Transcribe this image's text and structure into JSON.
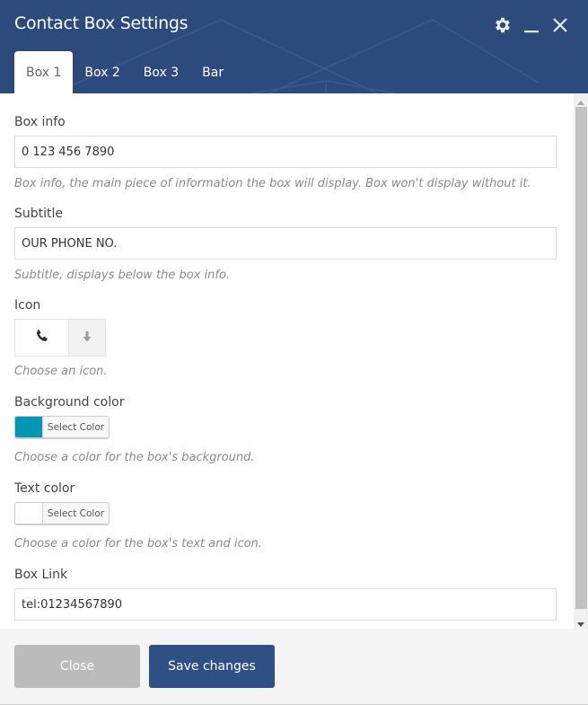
{
  "header": {
    "title": "Contact Box Settings",
    "actions": [
      {
        "icon": "gear-icon",
        "label": "Settings"
      },
      {
        "icon": "minimize-icon",
        "label": "Minimize"
      },
      {
        "icon": "close-icon",
        "label": "Close"
      }
    ]
  },
  "tabs": [
    {
      "label": "Box 1",
      "active": true
    },
    {
      "label": "Box 2",
      "active": false
    },
    {
      "label": "Box 3",
      "active": false
    },
    {
      "label": "Bar",
      "active": false
    }
  ],
  "form": {
    "box_info": {
      "label": "Box info",
      "value": "0 123 456 7890",
      "help": "Box info, the main piece of information the box will display. Box won't display without it."
    },
    "subtitle": {
      "label": "Subtitle",
      "value": "OUR PHONE NO.",
      "help": "Subtitle, displays below the box info."
    },
    "icon": {
      "label": "Icon",
      "selected_icon": "phone-icon",
      "dropdown_icon": "arrow-down-icon",
      "help": "Choose an icon."
    },
    "background_color": {
      "label": "Background color",
      "color": "#0097b2",
      "button_label": "Select Color",
      "help": "Choose a color for the box's background."
    },
    "text_color": {
      "label": "Text color",
      "color": "#ffffff",
      "button_label": "Select Color",
      "help": "Choose a color for the box's text and icon."
    },
    "box_link": {
      "label": "Box Link",
      "value": "tel:01234567890"
    }
  },
  "scrollbar": {
    "visible_fraction": 0.95,
    "position": 0
  },
  "footer": {
    "close_label": "Close",
    "save_label": "Save changes"
  },
  "colors": {
    "header_bg": "#2c4a7c",
    "primary_button": "#2f5085",
    "secondary_button": "#bbbbbb"
  }
}
